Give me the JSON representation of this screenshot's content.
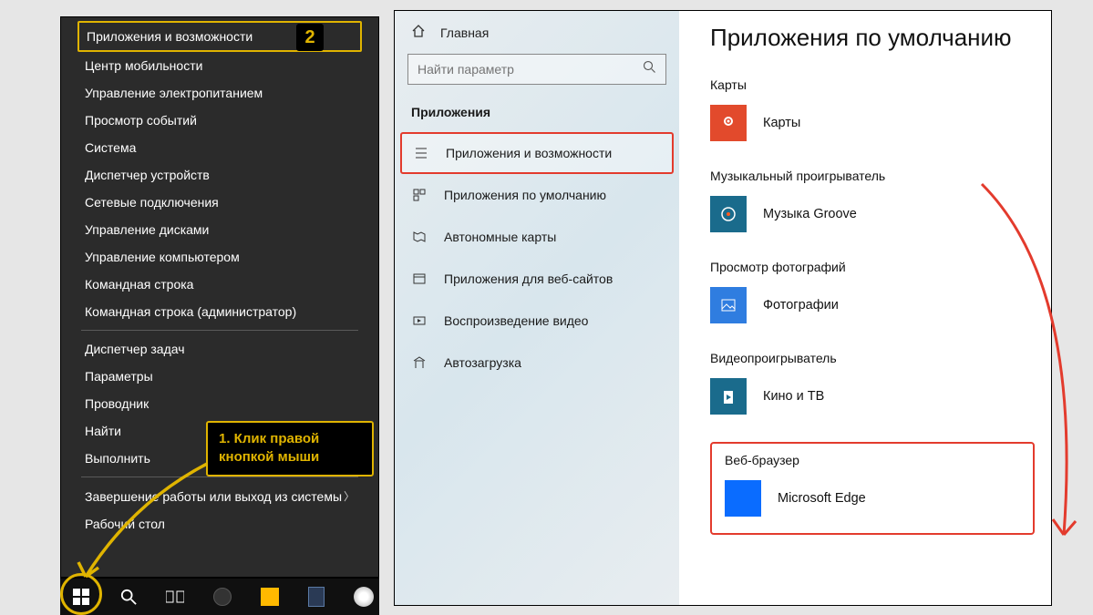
{
  "winx": {
    "items": [
      "Приложения и возможности",
      "Центр мобильности",
      "Управление электропитанием",
      "Просмотр событий",
      "Система",
      "Диспетчер устройств",
      "Сетевые подключения",
      "Управление дисками",
      "Управление компьютером",
      "Командная строка",
      "Командная строка (администратор)"
    ],
    "items2": [
      "Диспетчер задач",
      "Параметры",
      "Проводник",
      "Найти",
      "Выполнить"
    ],
    "items3": [
      "Завершение работы или выход из системы",
      "Рабочий стол"
    ],
    "badge": "2",
    "callout": "1. Клик правой кнопкой мыши"
  },
  "settings": {
    "home": "Главная",
    "search_placeholder": "Найти параметр",
    "section": "Приложения",
    "nav": [
      "Приложения и возможности",
      "Приложения по умолчанию",
      "Автономные карты",
      "Приложения для веб-сайтов",
      "Воспроизведение видео",
      "Автозагрузка"
    ],
    "content": {
      "title": "Приложения по умолчанию",
      "groups": [
        {
          "heading": "Карты",
          "app": "Карты",
          "icon": "maps"
        },
        {
          "heading": "Музыкальный проигрыватель",
          "app": "Музыка Groove",
          "icon": "groove"
        },
        {
          "heading": "Просмотр фотографий",
          "app": "Фотографии",
          "icon": "photos"
        },
        {
          "heading": "Видеопроигрыватель",
          "app": "Кино и ТВ",
          "icon": "movies"
        },
        {
          "heading": "Веб-браузер",
          "app": "Microsoft Edge",
          "icon": "edge"
        }
      ]
    }
  }
}
